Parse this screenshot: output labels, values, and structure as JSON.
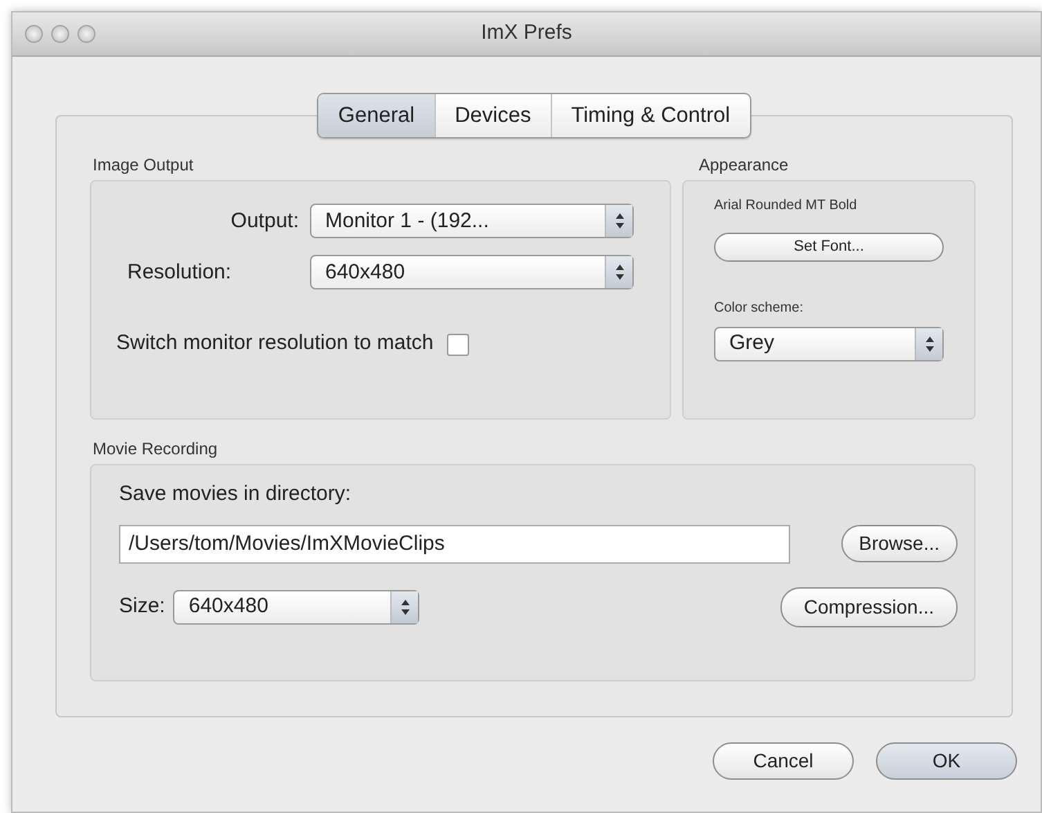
{
  "window": {
    "title": "ImX Prefs"
  },
  "tabs": [
    {
      "label": "General",
      "selected": true
    },
    {
      "label": "Devices",
      "selected": false
    },
    {
      "label": "Timing & Control",
      "selected": false
    }
  ],
  "image_output": {
    "title": "Image Output",
    "output": {
      "label": "Output:",
      "value": "Monitor 1 - (192..."
    },
    "resolution": {
      "label": "Resolution:",
      "value": "640x480"
    },
    "match_option": {
      "label": "Switch monitor resolution to match",
      "checked": false
    }
  },
  "appearance": {
    "title": "Appearance",
    "font_name": "Arial Rounded MT Bold",
    "set_font_button": "Set Font...",
    "color_scheme": {
      "label": "Color scheme:",
      "value": "Grey"
    }
  },
  "movie_recording": {
    "title": "Movie Recording",
    "directory_label": "Save movies in directory:",
    "directory_value": "/Users/tom/Movies/ImXMovieClips",
    "browse_button": "Browse...",
    "size": {
      "label": "Size:",
      "value": "640x480"
    },
    "compression_button": "Compression..."
  },
  "buttons": [
    {
      "label": "Cancel",
      "default": false
    },
    {
      "label": "OK",
      "default": true
    }
  ]
}
